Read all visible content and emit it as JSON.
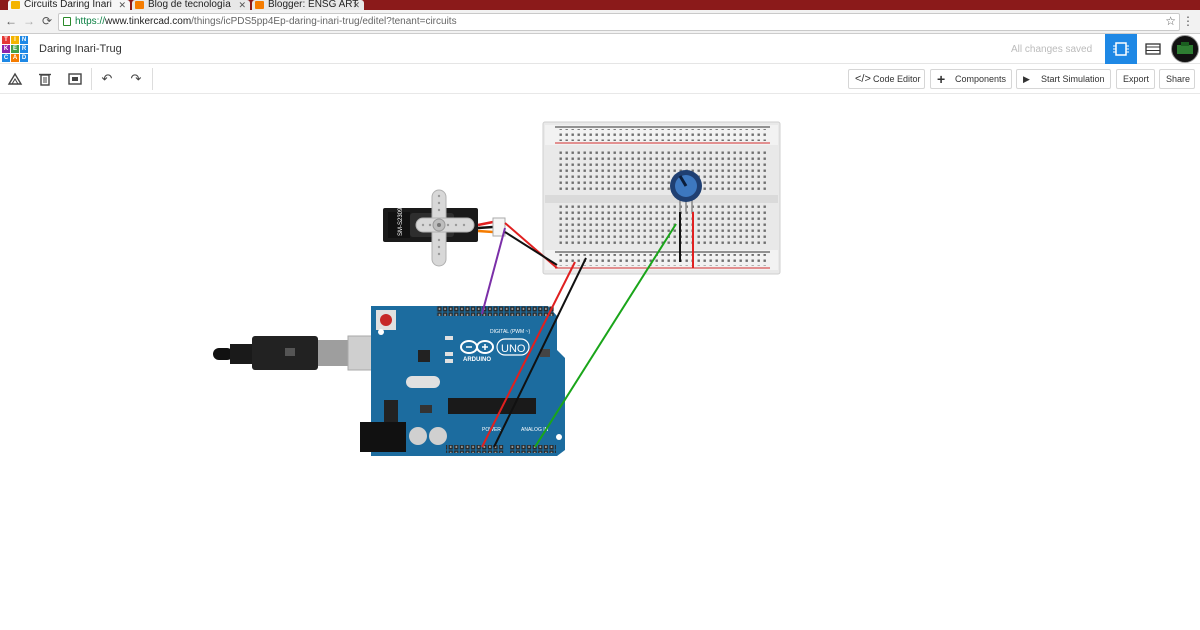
{
  "browser": {
    "tabs": [
      {
        "label": "Circuits Daring Inari",
        "favicon_color": "#f4b400"
      },
      {
        "label": "Blog de tecnología",
        "favicon_color": "#f57c00"
      },
      {
        "label": "Blogger: ENSG ART",
        "favicon_color": "#f57c00"
      }
    ],
    "url": {
      "scheme": "https://",
      "host": "www.tinkercad.com",
      "path": "/things/icPDS5pp4Ep-daring-inari-trug/editel?tenant=circuits"
    }
  },
  "app": {
    "logo_letters": [
      "T",
      "I",
      "N",
      "K",
      "E",
      "R",
      "C",
      "A",
      "D"
    ],
    "logo_colors": [
      "#e53935",
      "#f4b400",
      "#1e88e5",
      "#8e24aa",
      "#43a047",
      "#1e88e5",
      "#1e88e5",
      "#f57c00",
      "#1e88e5"
    ],
    "design_title": "Daring Inari-Trug",
    "save_status": "All changes saved",
    "accent": "#1e88e5"
  },
  "toolbar": {
    "code_editor": "Code Editor",
    "components": "Components",
    "start_simulation": "Start Simulation",
    "export": "Export",
    "share": "Share"
  },
  "circuit": {
    "servo_label": "SM-S2309S",
    "arduino_brand": "ARDUINO",
    "arduino_model": "UNO",
    "digital_header": "DIGITAL (PWM ~)",
    "power_header": "POWER",
    "analog_header": "ANALOG IN",
    "wire_colors": {
      "red": "#e02020",
      "black": "#111111",
      "green": "#1aa51a",
      "purple": "#7b2fa8"
    }
  }
}
